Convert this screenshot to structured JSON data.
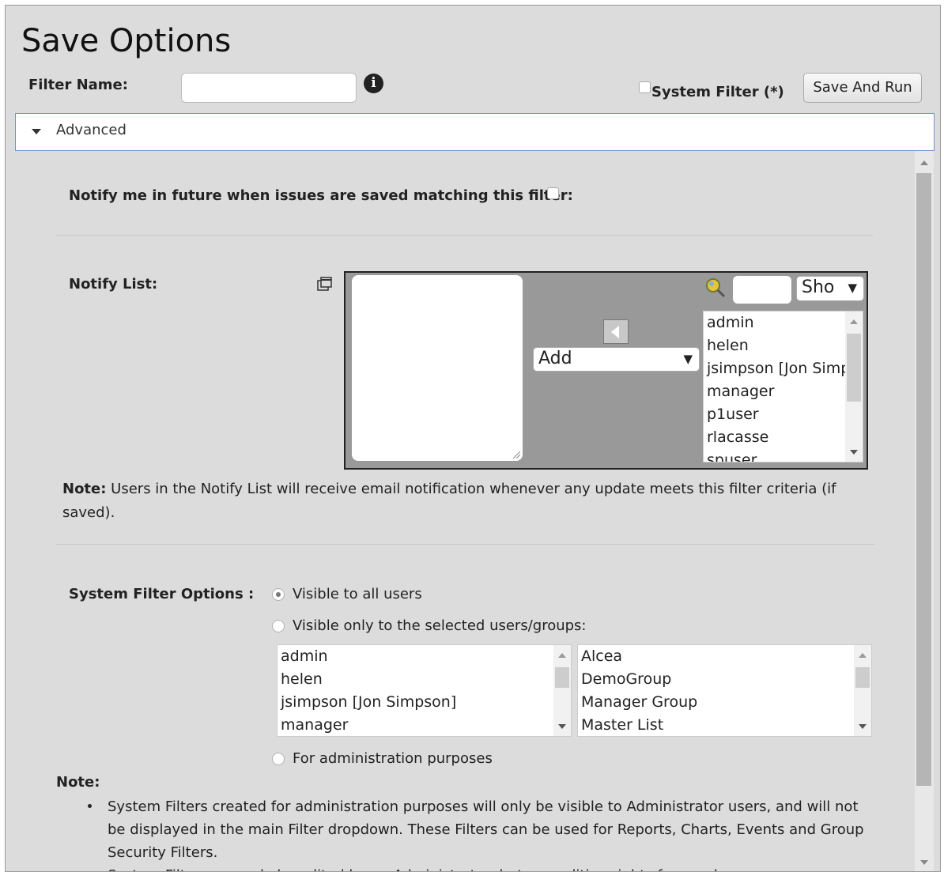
{
  "dialog": {
    "title": "Save Options",
    "filter_name_label": "Filter Name:",
    "filter_name_value": "",
    "info_icon_glyph": "i",
    "system_filter_label": "System Filter (*)",
    "system_filter_checked": false,
    "save_and_run_label": "Save And Run"
  },
  "advanced": {
    "label": "Advanced",
    "expanded": true,
    "notify_me_label": "Notify me in future when issues are saved matching this filter:",
    "notify_me_checked": false,
    "notify_list_label": "Notify List:",
    "picker": {
      "selected_users": [],
      "action_select": "Add",
      "action_arrow": "▼",
      "show_select": "Sho",
      "show_arrow": "▼",
      "search_value": "",
      "available_users": [
        "admin",
        "helen",
        "jsimpson [Jon Simpson]",
        "manager",
        "p1user",
        "rlacasse",
        "spuser"
      ]
    },
    "note1_label": "Note:",
    "note1_text": " Users in the Notify List will receive email notification whenever any update meets this filter criteria (if saved).",
    "system_filter_options_label": "System Filter Options :",
    "radio_options": [
      {
        "label": "Visible to all users",
        "checked": true
      },
      {
        "label": "Visible only to the selected users/groups:",
        "checked": false
      },
      {
        "label": "For administration purposes",
        "checked": false
      }
    ],
    "users_list": [
      "admin",
      "helen",
      "jsimpson [Jon Simpson]",
      "manager"
    ],
    "groups_list": [
      "Alcea",
      "DemoGroup",
      "Manager Group",
      "Master List"
    ],
    "note2_label": "Note:",
    "note2_bullets": [
      "System Filters created for administration purposes will only be visible to Administrator users, and will not be displayed in the main Filter dropdown. These Filters can be used for Reports, Charts, Events and Group Security Filters.",
      "System Filters can only be edited by an Administrator, but any editing rights for regular users..."
    ]
  },
  "colors": {
    "dialog_bg": "#dcdcdc",
    "advanced_border": "#6f93c5",
    "picker_bg": "#999999",
    "search_icon": "#e8c437"
  },
  "icons": [
    "info-icon",
    "chevron-down-icon",
    "restore-window-icon",
    "arrow-left-icon",
    "search-icon"
  ]
}
